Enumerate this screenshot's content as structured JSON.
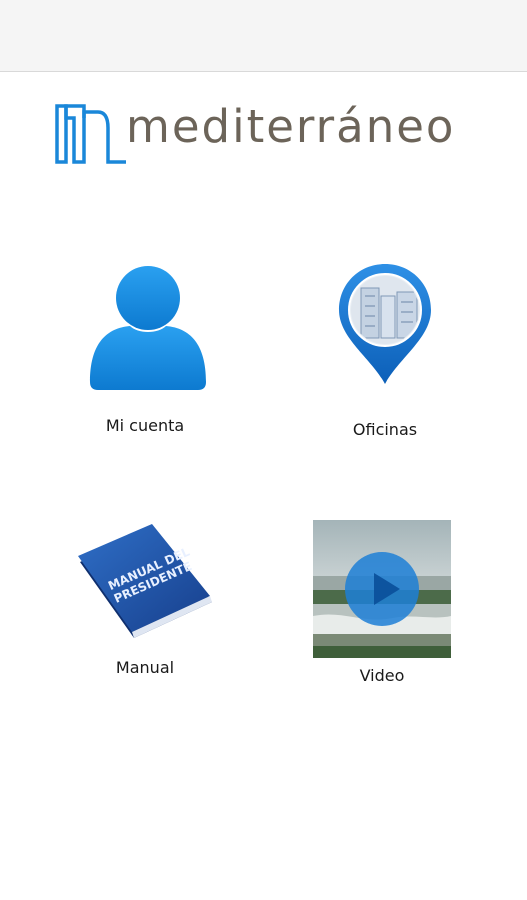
{
  "header": {
    "brand": "mediterráneo"
  },
  "tiles": [
    {
      "label": "Mi cuenta",
      "icon": "user-icon"
    },
    {
      "label": "Oficinas",
      "icon": "location-pin-icon"
    },
    {
      "label": "Manual",
      "icon": "book-icon",
      "cover_title": "MANUAL DEL PRESIDENTE"
    },
    {
      "label": "Video",
      "icon": "play-icon"
    }
  ],
  "colors": {
    "brand_blue": "#1a87d9",
    "brand_gray": "#6c6459",
    "topbar": "#f5f5f5"
  }
}
